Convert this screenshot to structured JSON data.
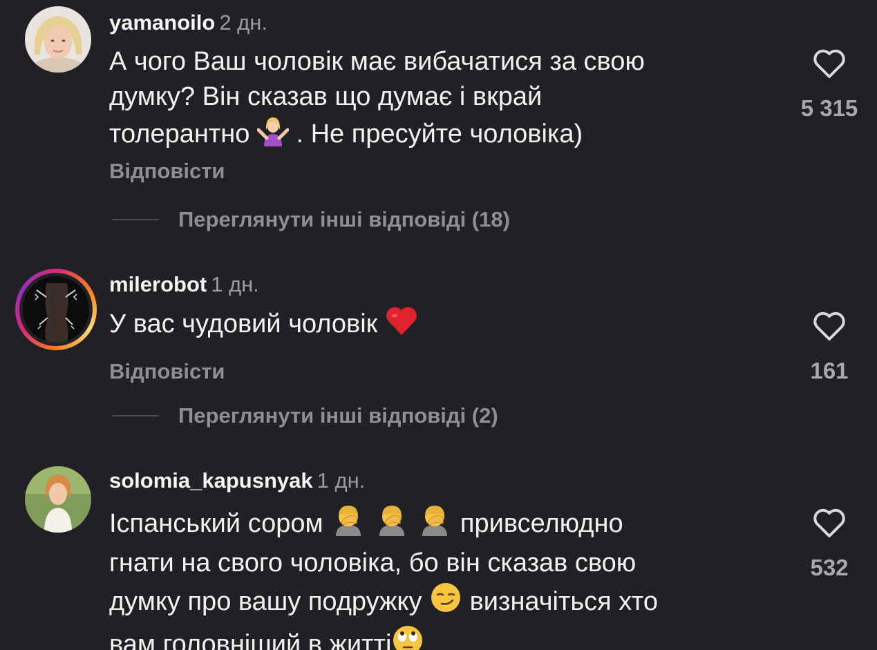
{
  "comments": [
    {
      "username": "yamanoilo",
      "time": "2 дн.",
      "text_lines": [
        "А чого Ваш чоловік має вибачатися за свою",
        "думку? Він сказав що думає і вкрай",
        "толерантно",
        ". Не пресуйте чоловіка)"
      ],
      "reply_label": "Відповісти",
      "likes": "5 315",
      "more_replies": "Переглянути інші відповіді (18)"
    },
    {
      "username": "milerobot",
      "time": "1 дн.",
      "text": "У вас чудовий чоловік",
      "reply_label": "Відповісти",
      "likes": "161",
      "more_replies": "Переглянути інші відповіді (2)"
    },
    {
      "username": "solomia_kapusnyak",
      "time": "1 дн.",
      "text_lines": [
        "Іспанський сором",
        "привселюдно",
        "гнати на свого чоловіка, бо він сказав свою",
        "думку про вашу подружку",
        "визначіться хто",
        "вам головніший в житті"
      ],
      "likes": "532"
    }
  ],
  "icons": {
    "like": "heart-outline-icon",
    "shrug": "person-shrugging-emoji",
    "heart": "red-heart-emoji",
    "facepalm": "person-facepalming-emoji",
    "smirk": "smirking-face-emoji",
    "eyeroll": "face-rolling-eyes-emoji"
  },
  "colors": {
    "background": "#212125",
    "text": "#f2f2f2",
    "secondary": "#8e8e94",
    "heart": "#e0212e"
  }
}
